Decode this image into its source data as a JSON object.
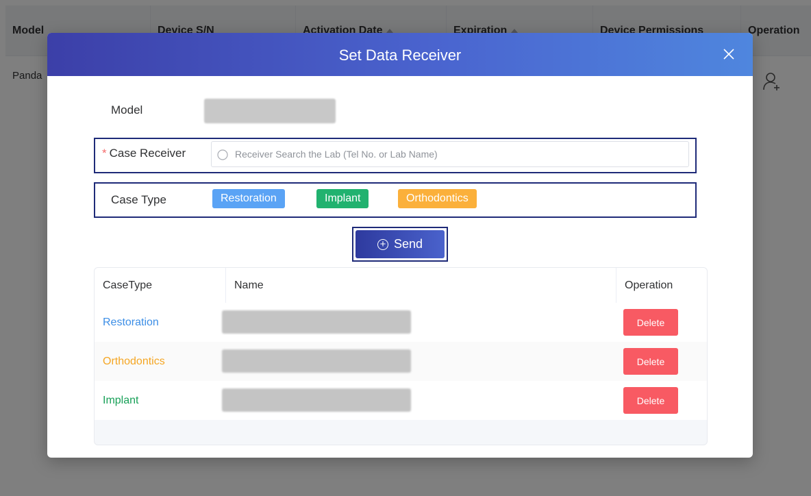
{
  "background_table": {
    "headers": [
      "Model",
      "Device S/N",
      "Activation Date",
      "Expiration",
      "Device Permissions",
      "Operation"
    ],
    "row": {
      "model": "Panda"
    }
  },
  "dialog": {
    "title": "Set Data Receiver",
    "close_icon": "close-icon",
    "model_label": "Model",
    "case_receiver": {
      "required_mark": "*",
      "label": "Case Receiver",
      "placeholder": "Receiver Search the Lab (Tel No. or Lab Name)"
    },
    "case_type": {
      "label": "Case Type",
      "tags": [
        {
          "label": "Restoration",
          "color": "#5aa3f5"
        },
        {
          "label": "Implant",
          "color": "#21b26f"
        },
        {
          "label": "Orthodontics",
          "color": "#fbb03b"
        }
      ]
    },
    "send_button": {
      "label": "Send",
      "icon": "plus-circle-icon"
    },
    "table": {
      "headers": [
        "CaseType",
        "Name",
        "Operation"
      ],
      "rows": [
        {
          "case_type": "Restoration",
          "color": "#3c8ee6",
          "action": "Delete"
        },
        {
          "case_type": "Orthodontics",
          "color": "#f5a623",
          "action": "Delete"
        },
        {
          "case_type": "Implant",
          "color": "#18a058",
          "action": "Delete"
        }
      ]
    }
  }
}
